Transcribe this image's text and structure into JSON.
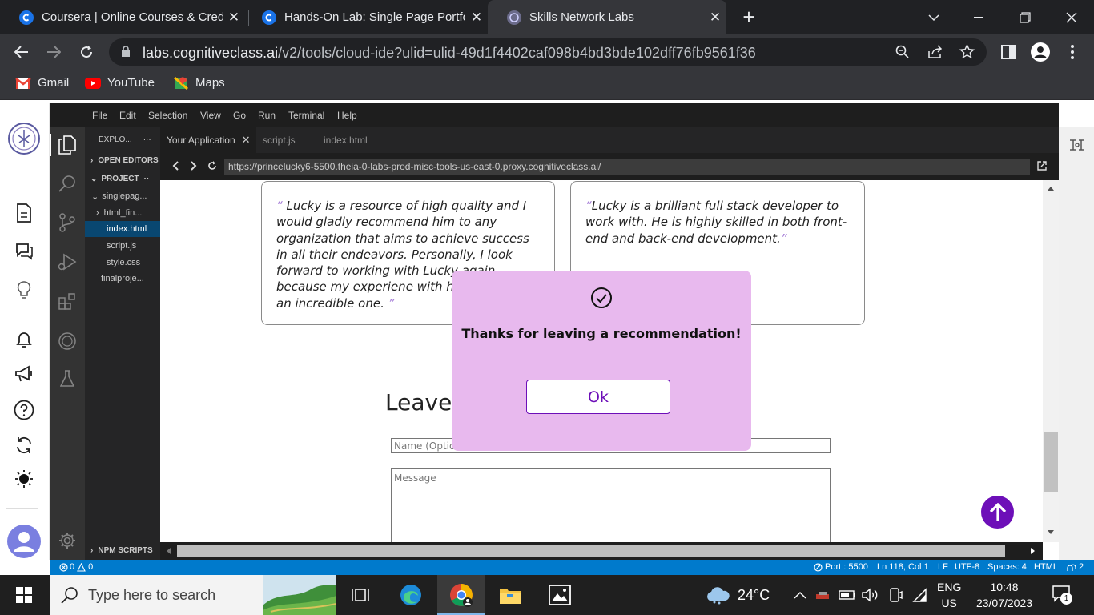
{
  "browser": {
    "tabs": [
      {
        "title": "Coursera | Online Courses & Credentials",
        "active": false
      },
      {
        "title": "Hands-On Lab: Single Page Portfolio",
        "active": false
      },
      {
        "title": "Skills Network Labs",
        "active": true
      }
    ],
    "new_tab_label": "+",
    "url_host": "labs.cognitiveclass.ai",
    "url_path": "/v2/tools/cloud-ide?ulid=ulid-49d1f4402caf098b4bd3bde102dff76fb9561f36",
    "bookmarks": [
      "Gmail",
      "YouTube",
      "Maps"
    ]
  },
  "ide": {
    "menu": [
      "File",
      "Edit",
      "Selection",
      "View",
      "Go",
      "Run",
      "Terminal",
      "Help"
    ],
    "explorer": {
      "title": "EXPLO...",
      "more": "···",
      "open_editors": "OPEN EDITORS",
      "project": "PROJECT",
      "project_dots": "··",
      "items": [
        {
          "label": "singlepag...",
          "indent": 1
        },
        {
          "label": "html_fin...",
          "indent": 2
        },
        {
          "label": "index.html",
          "indent": 3,
          "selected": true
        },
        {
          "label": "script.js",
          "indent": 3
        },
        {
          "label": "style.css",
          "indent": 3
        },
        {
          "label": "finalproje...",
          "indent": 1
        }
      ],
      "npm_scripts": "NPM SCRIPTS"
    },
    "editor_tabs": [
      {
        "label": "Your Application",
        "active": true,
        "closable": true
      },
      {
        "label": "script.js",
        "active": false
      },
      {
        "label": "index.html",
        "active": false
      }
    ],
    "preview_url": "https://princelucky6-5500.theia-0-labs-prod-misc-tools-us-east-0.proxy.cognitiveclass.ai/",
    "status": {
      "problems": "0",
      "warnings": "0",
      "port": "Port : 5500",
      "position": "Ln 118, Col 1",
      "eol": "LF",
      "encoding": "UTF-8",
      "spaces": "Spaces: 4",
      "language": "HTML",
      "notifications": "2"
    }
  },
  "page": {
    "recommendations": [
      {
        "open_quote": "“",
        "text": " Lucky is a resource of high quality and I would gladly recommend him to any organization that aims to achieve success in all their endeavors. Personally, I look forward to working with Lucky again because my experiene with him has been an incredible one. ",
        "close_quote": "”"
      },
      {
        "open_quote": "“",
        "text": "Lucky is a brilliant full stack developer to work with. He is highly skilled in both front-end and back-end development.",
        "close_quote": "”"
      }
    ],
    "form_heading": "Leave a Recommendation",
    "name_placeholder": "Name (Optional)",
    "message_placeholder": "Message",
    "modal": {
      "message": "Thanks for leaving a recommendation!",
      "ok_label": "Ok"
    }
  },
  "taskbar": {
    "search_placeholder": "Type here to search",
    "weather": "24°C",
    "language": "ENG",
    "region": "US",
    "time": "10:48",
    "date": "23/07/2023",
    "notification_count": "1"
  }
}
